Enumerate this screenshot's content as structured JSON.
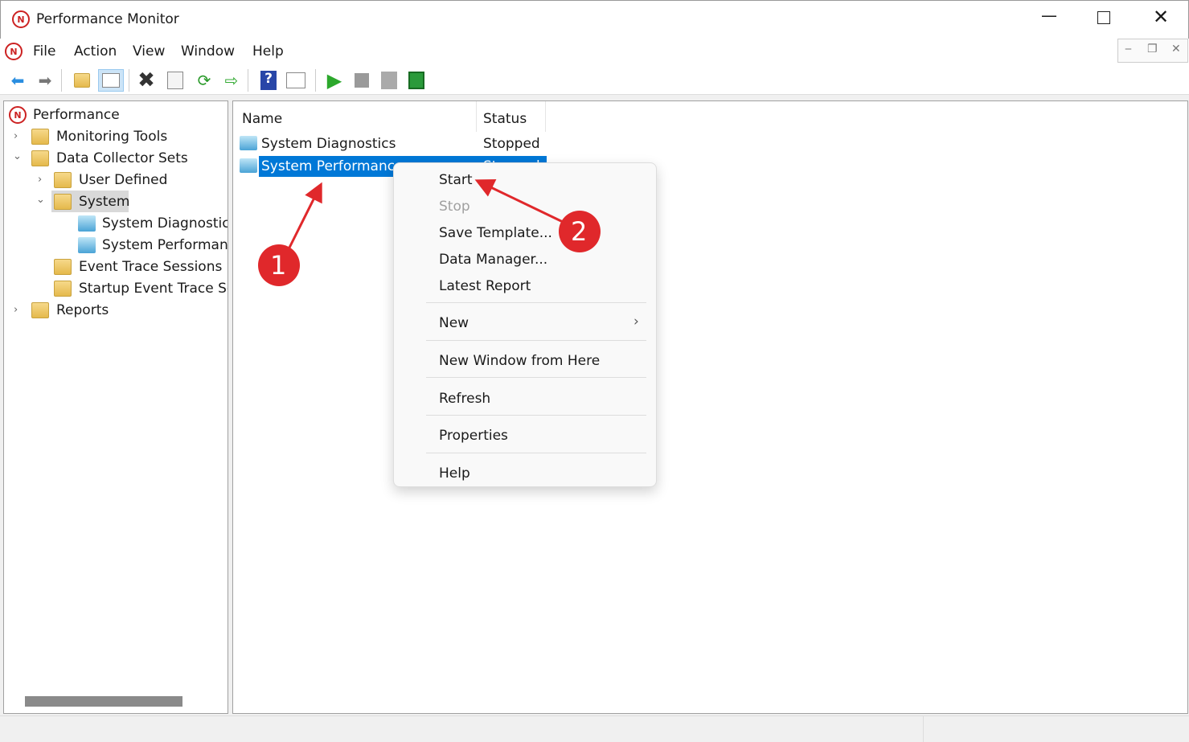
{
  "window": {
    "title": "Performance Monitor"
  },
  "menu": [
    "File",
    "Action",
    "View",
    "Window",
    "Help"
  ],
  "toolbar": [
    "back-icon",
    "forward-icon",
    "up-folder-icon",
    "show-hide-tree-icon",
    "delete-icon",
    "properties-icon",
    "refresh-icon",
    "export-icon",
    "help-icon",
    "show-hide-action-icon",
    "start-icon",
    "stop-icon",
    "new-icon",
    "data-manager-icon"
  ],
  "tree": {
    "root": "Performance",
    "monitoring": "Monitoring Tools",
    "dcs": "Data Collector Sets",
    "user": "User Defined",
    "system": "System",
    "sysdiag": "System Diagnostics",
    "sysperf": "System Performance",
    "ets": "Event Trace Sessions",
    "sets": "Startup Event Trace Sess",
    "reports": "Reports"
  },
  "list": {
    "columns": [
      "Name",
      "Status"
    ],
    "rows": [
      {
        "name": "System Diagnostics",
        "status": "Stopped"
      },
      {
        "name": "System Performance",
        "status": "Stopped"
      }
    ]
  },
  "context_menu": {
    "start": "Start",
    "stop": "Stop",
    "save": "Save Template...",
    "dm": "Data Manager...",
    "latest": "Latest Report",
    "new": "New",
    "newwin": "New Window from Here",
    "refresh": "Refresh",
    "props": "Properties",
    "help": "Help"
  },
  "annotations": {
    "one": "1",
    "two": "2"
  },
  "colors": {
    "selection": "#0078d7",
    "annotation": "#e0282b"
  }
}
